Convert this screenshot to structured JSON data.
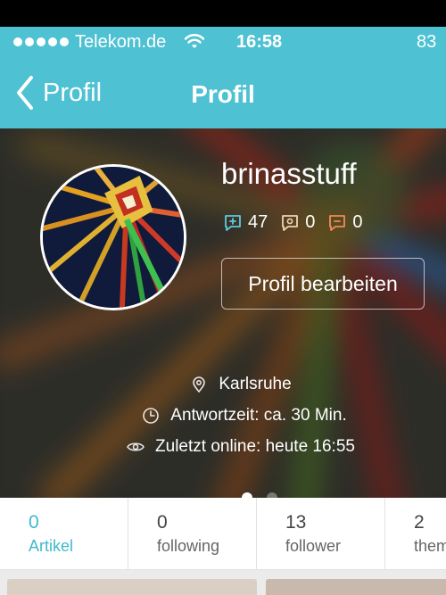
{
  "status_bar": {
    "carrier": "Telekom.de",
    "time": "16:58",
    "battery": "83"
  },
  "nav": {
    "back_label": "Profil",
    "title": "Profil"
  },
  "profile": {
    "username": "brinasstuff",
    "counts": {
      "positive": "47",
      "neutral": "0",
      "negative": "0"
    },
    "edit_button": "Profil bearbeiten",
    "location": "Karlsruhe",
    "response_time": "Antwortzeit: ca. 30 Min.",
    "last_online": "Zuletzt online: heute 16:55"
  },
  "carousel": {
    "pages": 2,
    "active": 1
  },
  "tabs": [
    {
      "count": "0",
      "label": "Artikel",
      "active": true
    },
    {
      "count": "0",
      "label": "following"
    },
    {
      "count": "13",
      "label": "follower"
    },
    {
      "count": "2",
      "label": "them"
    }
  ],
  "colors": {
    "accent": "#4ec1d2",
    "active_tab": "#3fb8cd"
  }
}
